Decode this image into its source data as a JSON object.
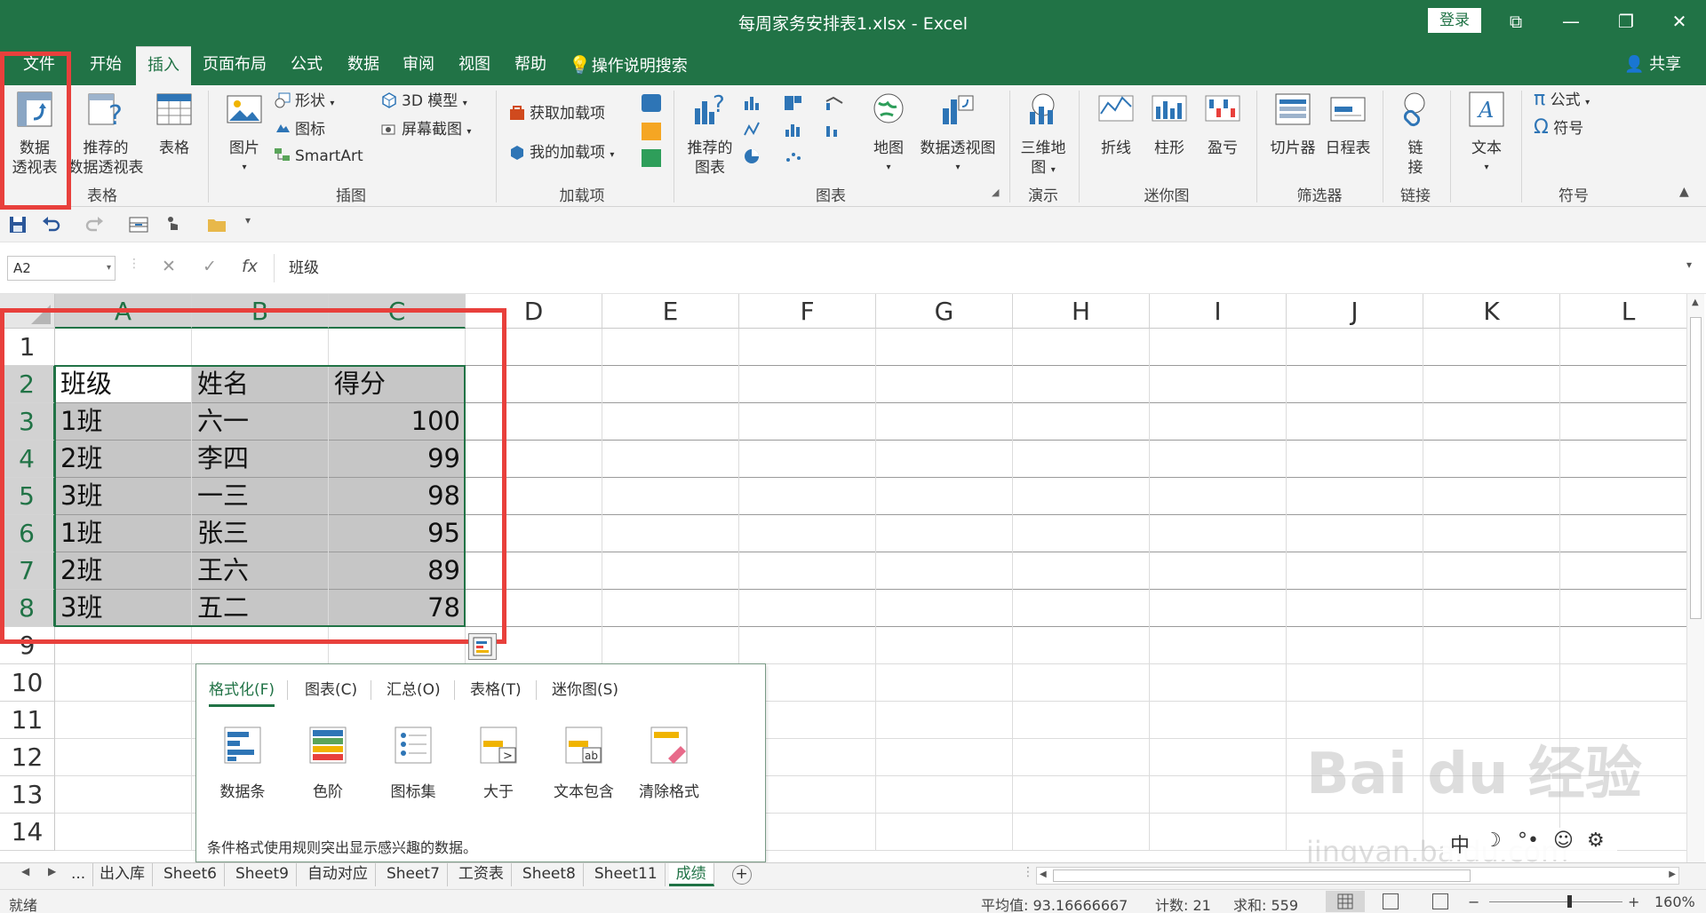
{
  "window": {
    "title": "每周家务安排表1.xlsx  -  Excel",
    "login_label": "登录",
    "controls": {
      "ribbon_display": "⧉",
      "minimize": "—",
      "restore": "❐",
      "close": "✕"
    }
  },
  "tabs": [
    {
      "label": "文件",
      "active": false
    },
    {
      "label": "开始",
      "active": false
    },
    {
      "label": "插入",
      "active": true
    },
    {
      "label": "页面布局",
      "active": false
    },
    {
      "label": "公式",
      "active": false
    },
    {
      "label": "数据",
      "active": false
    },
    {
      "label": "审阅",
      "active": false
    },
    {
      "label": "视图",
      "active": false
    },
    {
      "label": "帮助",
      "active": false
    }
  ],
  "tell_me": "操作说明搜索",
  "share_label": "共享",
  "ribbon": {
    "groups": {
      "tables": "表格",
      "illustrations": "插图",
      "addins": "加载项",
      "charts": "图表",
      "tours": "演示",
      "sparklines": "迷你图",
      "filters": "筛选器",
      "links": "链接",
      "symbols": "符号"
    },
    "buttons": {
      "pivot_table": [
        "数据",
        "透视表"
      ],
      "recommended_pivot": [
        "推荐的",
        "数据透视表"
      ],
      "table": "表格",
      "pictures": "图片",
      "shapes": "形状",
      "icons": "图标",
      "smartart": "SmartArt",
      "model3d": "3D 模型",
      "screenshot": "屏幕截图",
      "get_addins": "获取加载项",
      "my_addins": "我的加载项",
      "recommended_charts": [
        "推荐的",
        "图表"
      ],
      "maps": "地图",
      "pivot_chart": "数据透视图",
      "map3d": [
        "三维地",
        "图"
      ],
      "line": "折线",
      "column": "柱形",
      "winloss": "盈亏",
      "slicer": "切片器",
      "timeline": "日程表",
      "link": [
        "链",
        "接"
      ],
      "text": "文本",
      "equation": "公式",
      "symbol": "符号"
    }
  },
  "formula_bar": {
    "name_box": "A2",
    "cancel": "✕",
    "enter": "✓",
    "fx": "fx",
    "content": "班级"
  },
  "columns": [
    "A",
    "B",
    "C",
    "D",
    "E",
    "F",
    "G",
    "H",
    "I",
    "J",
    "K",
    "L"
  ],
  "rows": [
    "1",
    "2",
    "3",
    "4",
    "5",
    "6",
    "7",
    "8",
    "9",
    "10",
    "11",
    "12",
    "13",
    "14"
  ],
  "table": {
    "header": [
      "班级",
      "姓名",
      "得分"
    ],
    "rows": [
      [
        "1班",
        "六一",
        "100"
      ],
      [
        "2班",
        "李四",
        "99"
      ],
      [
        "3班",
        "一三",
        "98"
      ],
      [
        "1班",
        "张三",
        "95"
      ],
      [
        "2班",
        "王六",
        "89"
      ],
      [
        "3班",
        "五二",
        "78"
      ]
    ]
  },
  "quick_analysis": {
    "tabs": [
      "格式化(F)",
      "图表(C)",
      "汇总(O)",
      "表格(T)",
      "迷你图(S)"
    ],
    "options": [
      "数据条",
      "色阶",
      "图标集",
      "大于",
      "文本包含",
      "清除格式"
    ],
    "description": "条件格式使用规则突出显示感兴趣的数据。"
  },
  "sheets": {
    "more": "...",
    "tabs": [
      "出入库",
      "Sheet6",
      "Sheet9",
      "自动对应",
      "Sheet7",
      "工资表",
      "Sheet8",
      "Sheet11",
      "成绩"
    ],
    "active": "成绩",
    "add": "+"
  },
  "status": {
    "ready": "就绪",
    "average": "平均值: 93.16666667",
    "count": "计数: 21",
    "sum": "求和: 559",
    "zoom": "160%"
  },
  "ime": [
    "中",
    "☽",
    "°•",
    "☺",
    "⚙"
  ],
  "watermark": {
    "main": "Bai du 经验",
    "sub": "jingyan.baidu.com"
  },
  "colors": {
    "brand": "#217346",
    "highlight_box": "#e8403c",
    "selection": "#c6c6c6"
  }
}
